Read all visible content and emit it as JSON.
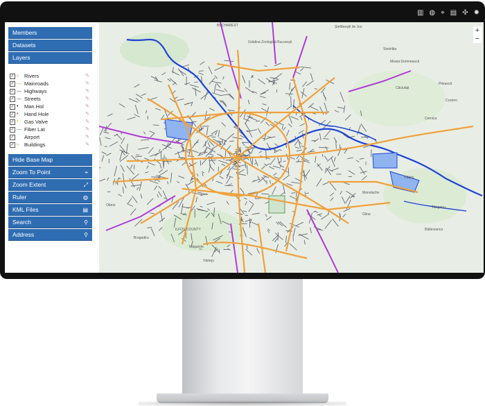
{
  "topbar": {
    "icons": [
      "stats-icon",
      "globe-icon",
      "pin-icon",
      "print-icon",
      "compass-icon",
      "settings-icon"
    ]
  },
  "sidebar": {
    "members": "Members",
    "datasets": "Datasets",
    "layers": "Layers",
    "layer_items": [
      {
        "label": "Rivers",
        "symbol": "▹"
      },
      {
        "label": "Mainroads",
        "symbol": "—"
      },
      {
        "label": "Highways",
        "symbol": "—"
      },
      {
        "label": "Streets",
        "symbol": "—"
      },
      {
        "label": "Man Hol",
        "symbol": "•"
      },
      {
        "label": "Hand Hole",
        "symbol": "•"
      },
      {
        "label": "Gas Valve",
        "symbol": "•"
      },
      {
        "label": "Fiber Lat",
        "symbol": "—"
      },
      {
        "label": "Airport",
        "symbol": " "
      },
      {
        "label": "Buildings",
        "symbol": "▹"
      }
    ],
    "hide_base_map": "Hide Base Map",
    "zoom_to_point": "Zoom To Point",
    "zoom_extent": "Zoom Extent",
    "ruler": "Ruler",
    "kml_files": "KML Files",
    "search": "Search",
    "address": "Address"
  },
  "map": {
    "labels": [
      "BUCHAREST",
      "Ștefăneștii de Jos",
      "Grădina Zoologică Bucureşti",
      "Sindrilita",
      "Moara Domnească",
      "Căciulați",
      "Pitească",
      "Cozieni",
      "Cernica",
      "Cățelu",
      "Manolache",
      "Tânganu",
      "Glina",
      "Bălăceanca",
      "Măgurele",
      "Vârteju",
      "Bragadiru",
      "Otteni",
      "ILFOV COUNTY"
    ]
  },
  "colors": {
    "sidebar_button": "#2f6db3",
    "mainroad": "#f0a03a",
    "highway": "#b03ad8",
    "river": "#1f44d8",
    "streets": "#3a3a4a"
  }
}
